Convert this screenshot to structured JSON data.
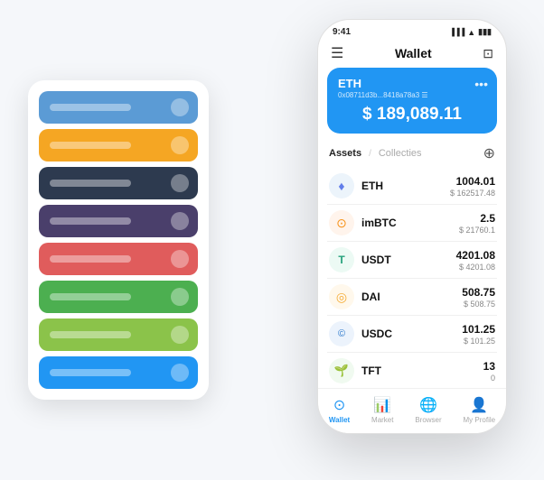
{
  "scene": {
    "background": "#f5f7fa"
  },
  "card_stack": {
    "cards": [
      {
        "color": "#5b9bd5",
        "label_visible": true
      },
      {
        "color": "#f5a623",
        "label_visible": true
      },
      {
        "color": "#2d3a4f",
        "label_visible": true
      },
      {
        "color": "#4a3f6b",
        "label_visible": true
      },
      {
        "color": "#e05c5c",
        "label_visible": true
      },
      {
        "color": "#4caf50",
        "label_visible": true
      },
      {
        "color": "#8bc34a",
        "label_visible": true
      },
      {
        "color": "#2196f3",
        "label_visible": true
      }
    ]
  },
  "phone": {
    "status_bar": {
      "time": "9:41",
      "battery": "■■■",
      "wifi": "▲",
      "signal": "|||"
    },
    "nav": {
      "menu_icon": "☰",
      "title": "Wallet",
      "scan_icon": "⊡"
    },
    "hero": {
      "token": "ETH",
      "address": "0x08711d3b...8418a78a3 ☰",
      "balance_prefix": "$",
      "balance": "189,089.11"
    },
    "assets": {
      "tab_active": "Assets",
      "tab_separator": "/",
      "tab_inactive": "Collecties",
      "add_icon": "⊕",
      "items": [
        {
          "name": "ETH",
          "icon_char": "♦",
          "icon_bg": "#ecf4fb",
          "icon_color": "#627eea",
          "amount": "1004.01",
          "value": "$ 162517.48"
        },
        {
          "name": "imBTC",
          "icon_char": "⊙",
          "icon_bg": "#fff4ec",
          "icon_color": "#f7931a",
          "amount": "2.5",
          "value": "$ 21760.1"
        },
        {
          "name": "USDT",
          "icon_char": "T",
          "icon_bg": "#ecfaf4",
          "icon_color": "#26a17b",
          "amount": "4201.08",
          "value": "$ 4201.08"
        },
        {
          "name": "DAI",
          "icon_char": "◎",
          "icon_bg": "#fff8ec",
          "icon_color": "#f5ac37",
          "amount": "508.75",
          "value": "$ 508.75"
        },
        {
          "name": "USDC",
          "icon_char": "©",
          "icon_bg": "#ecf3fc",
          "icon_color": "#2775ca",
          "amount": "101.25",
          "value": "$ 101.25"
        },
        {
          "name": "TFT",
          "icon_char": "🌱",
          "icon_bg": "#f0faf0",
          "icon_color": "#4caf50",
          "amount": "13",
          "value": "0"
        }
      ]
    },
    "bottom_nav": [
      {
        "id": "wallet",
        "label": "Wallet",
        "icon": "⊙",
        "active": true
      },
      {
        "id": "market",
        "label": "Market",
        "icon": "📈",
        "active": false
      },
      {
        "id": "browser",
        "label": "Browser",
        "icon": "👤",
        "active": false
      },
      {
        "id": "profile",
        "label": "My Profile",
        "icon": "👤",
        "active": false
      }
    ]
  }
}
